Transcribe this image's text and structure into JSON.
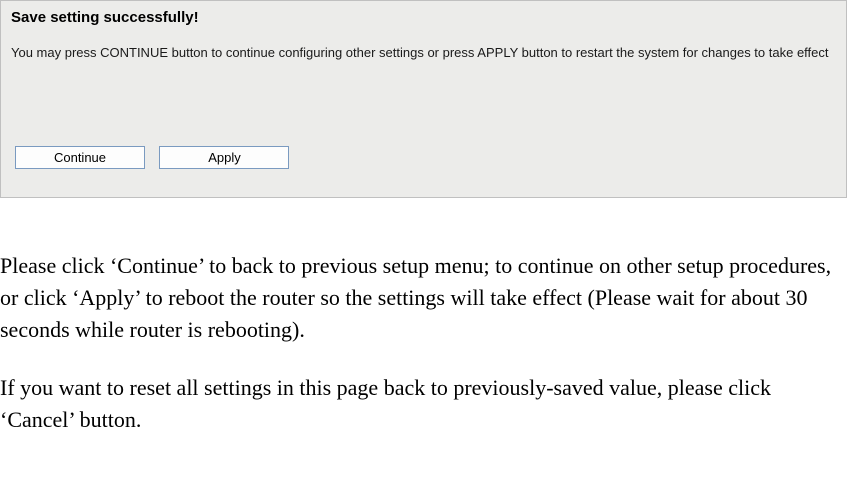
{
  "panel": {
    "title": "Save setting successfully!",
    "description": "You may press CONTINUE button to continue configuring other settings or press APPLY button to restart the system for changes to take effect",
    "continue_label": "Continue",
    "apply_label": "Apply"
  },
  "doc": {
    "para1": "Please click ‘Continue’ to back to previous setup menu; to continue on other setup procedures, or click ‘Apply’ to reboot the router so the settings will take effect (Please wait for about 30 seconds while router is rebooting).",
    "para2": "If you want to reset all settings in this page back to previously-saved value, please click ‘Cancel’ button."
  }
}
